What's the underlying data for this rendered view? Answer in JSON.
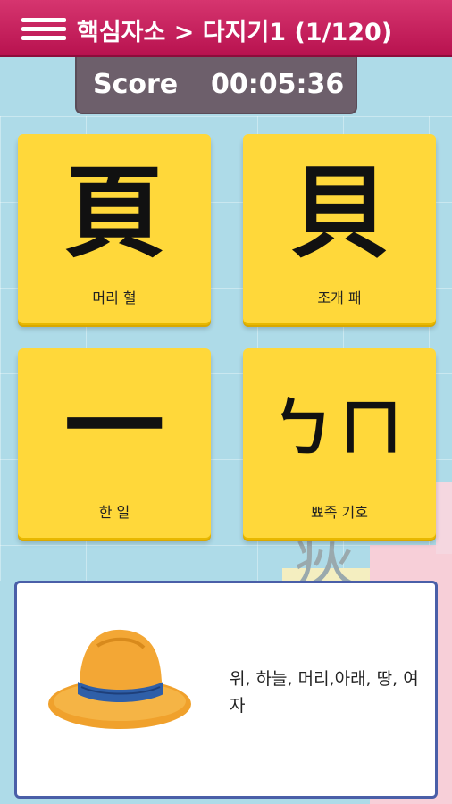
{
  "header": {
    "title": "핵심자소 > 다지기1 (1/120)"
  },
  "score": {
    "label": "Score",
    "time": "00:05:36"
  },
  "cards": [
    {
      "glyph": "頁",
      "label": "머리 혈"
    },
    {
      "glyph": "貝",
      "label": "조개 패"
    },
    {
      "glyph": "一",
      "label": "한 일"
    },
    {
      "glyph": "ㄅㄇ",
      "label": "뾰족 기호"
    }
  ],
  "hint": {
    "image": "hat-icon",
    "text": "위, 하늘, 머리,아래, 땅, 여자"
  },
  "colors": {
    "header": "#c4215d",
    "card": "#ffd83a",
    "score_box": "#6d5f6b",
    "panel_border": "#4a5fa8"
  }
}
